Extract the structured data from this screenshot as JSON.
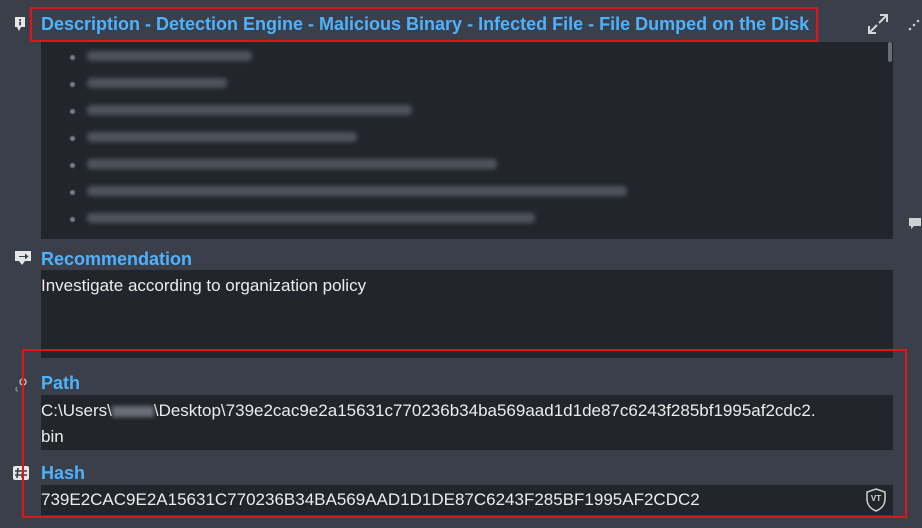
{
  "description": {
    "title": "Description - Detection Engine - Malicious Binary - Infected File - File Dumped on the Disk"
  },
  "recommendation": {
    "title": "Recommendation",
    "text": "Investigate according to organization policy"
  },
  "path": {
    "title": "Path",
    "value_part1": "C:\\Users\\",
    "value_part2": "\\Desktop\\739e2cac9e2a15631c770236b34ba569aad1d1de87c6243f285bf1995af2cdc2.",
    "value_line2": "bin"
  },
  "hash": {
    "title": "Hash",
    "value": "739E2CAC9E2A15631C770236B34BA569AAD1D1DE87C6243F285BF1995AF2CDC2",
    "vt_label": "VT"
  },
  "colors": {
    "heading": "#4db3ff",
    "highlight": "#e0141b",
    "panel": "#22252b",
    "background": "#3b3f49"
  }
}
